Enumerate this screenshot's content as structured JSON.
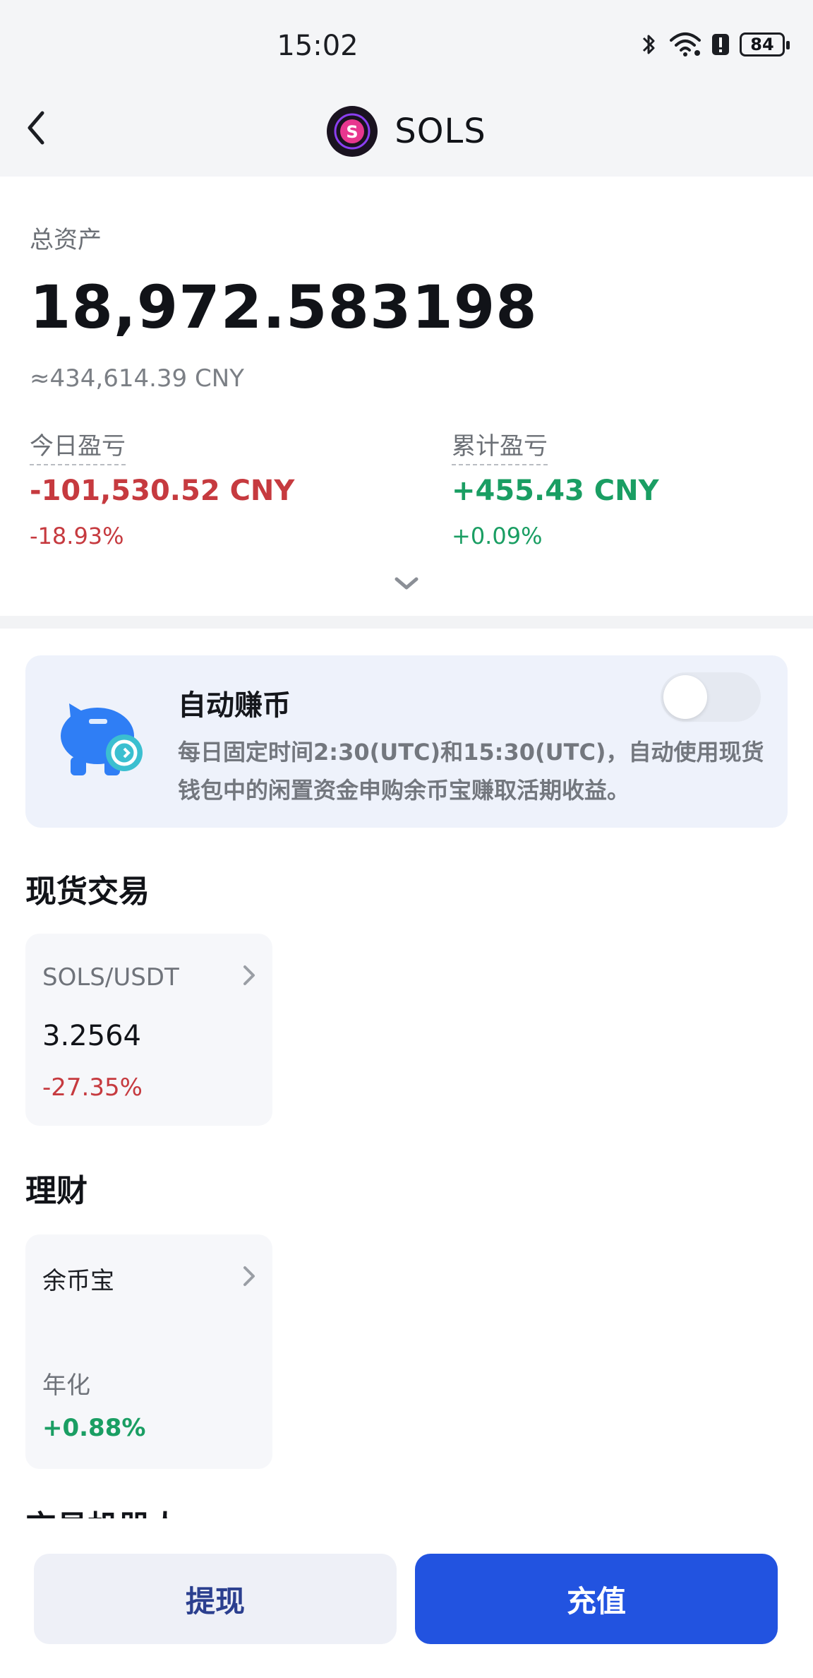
{
  "status": {
    "time": "15:02",
    "battery": "84"
  },
  "header": {
    "title": "SOLS",
    "logo_glyph": "S"
  },
  "assets": {
    "total_label": "总资产",
    "total_value": "18,972.583198",
    "total_cny": "≈434,614.39 CNY",
    "today_label": "今日盈亏",
    "today_value": "-101,530.52 CNY",
    "today_pct": "-18.93%",
    "cum_label": "累计盈亏",
    "cum_value": "+455.43 CNY",
    "cum_pct": "+0.09%"
  },
  "auto_earn": {
    "title": "自动赚币",
    "description": "每日固定时间2:30(UTC)和15:30(UTC)，自动使用现货钱包中的闲置资金申购余币宝赚取活期收益。",
    "toggle_on": false
  },
  "spot": {
    "section_title": "现货交易",
    "pair": "SOLS/USDT",
    "price": "3.2564",
    "change": "-27.35%"
  },
  "finance": {
    "section_title": "理财",
    "product": "余币宝",
    "rate_label": "年化",
    "rate": "+0.88%"
  },
  "robot": {
    "section_title": "交易机器人"
  },
  "actions": {
    "withdraw": "提现",
    "deposit": "充值"
  },
  "colors": {
    "negative": "#c63a3f",
    "positive": "#1a9e63",
    "primary": "#2253e0"
  }
}
